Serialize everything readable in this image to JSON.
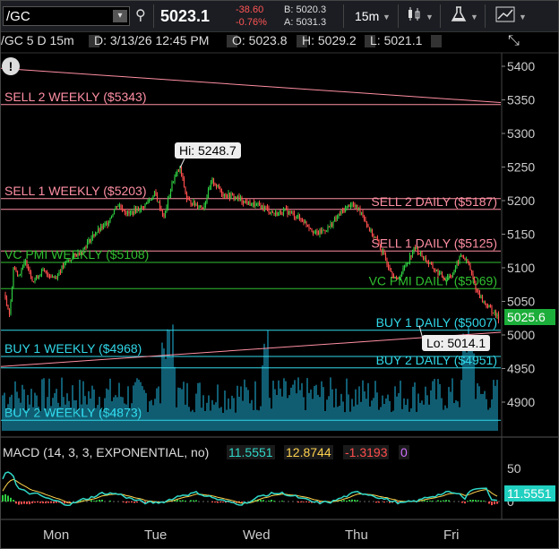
{
  "toolbar": {
    "symbol": "/GC",
    "last_price": "5023.1",
    "net_change": "-38.60",
    "pct_change": "-0.76%",
    "bid": "B: 5020.3",
    "ask": "A: 5031.3",
    "timeframe": "15m"
  },
  "info": {
    "symbol_period": "/GC 5 D 15m",
    "date": "D: 3/13/26 12:45 PM",
    "open": "O: 5023.8",
    "high": "H: 5029.2",
    "low": "L: 5021.1"
  },
  "levels": [
    {
      "label": "SELL 2 WEEKLY ($5343)",
      "price": 5343,
      "color": "#ff8fa3",
      "side": "left"
    },
    {
      "label": "SELL 1 WEEKLY ($5203)",
      "price": 5203,
      "color": "#ff8fa3",
      "side": "left"
    },
    {
      "label": "SELL 2 DAILY ($5187)",
      "price": 5187,
      "color": "#ff8fa3",
      "side": "right"
    },
    {
      "label": "SELL 1 DAILY ($5125)",
      "price": 5125,
      "color": "#ff8fa3",
      "side": "right"
    },
    {
      "label": "VC PMI WEEKLY ($5108)",
      "price": 5108,
      "color": "#30c030",
      "side": "left"
    },
    {
      "label": "VC PMI DAILY ($5069)",
      "price": 5069,
      "color": "#30c030",
      "side": "right"
    },
    {
      "label": "BUY 1 DAILY ($5007)",
      "price": 5007,
      "color": "#30d8e8",
      "side": "right"
    },
    {
      "label": "BUY 1 WEEKLY ($4968)",
      "price": 4968,
      "color": "#30d8e8",
      "side": "left"
    },
    {
      "label": "BUY 2 DAILY ($4951)",
      "price": 4951,
      "color": "#30d8e8",
      "side": "right"
    },
    {
      "label": "BUY 2 WEEKLY ($4873)",
      "price": 4873,
      "color": "#30d8e8",
      "side": "left"
    }
  ],
  "callouts": {
    "high": "Hi: 5248.7",
    "low": "Lo: 5014.1",
    "last": "5025.6",
    "macd_last": "11.5551"
  },
  "axis": {
    "price_ticks": [
      "5400",
      "5350",
      "5300",
      "5250",
      "5200",
      "5150",
      "5100",
      "5050",
      "5000",
      "4950",
      "4900"
    ],
    "macd_ticks": [
      "50",
      "0"
    ],
    "days": [
      "Mon",
      "Tue",
      "Wed",
      "Thu",
      "Fri"
    ]
  },
  "macd": {
    "title": "MACD (14, 3, 3, EXPONENTIAL, no)",
    "value": "11.5551",
    "avg": "12.8744",
    "diff": "-1.3193",
    "flag": "0"
  },
  "colors": {
    "up": "#2ecc40",
    "down": "#ff4d4d",
    "volume": "#1a8fb0",
    "macd_line": "#30d8c8",
    "macd_avg": "#ffd24d"
  }
}
